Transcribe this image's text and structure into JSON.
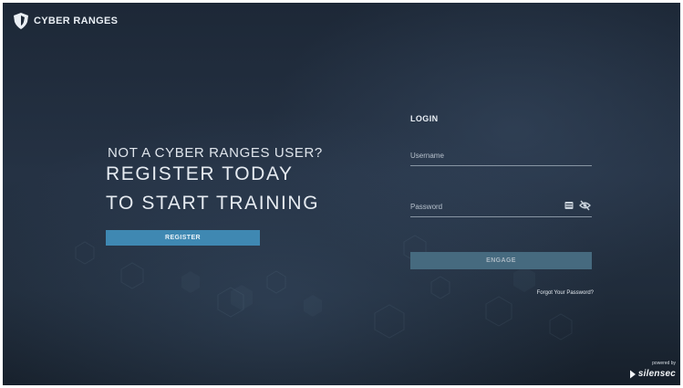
{
  "brand": {
    "logo_icon": "cyber-ranges-shield-icon",
    "name": "CYBER RANGES"
  },
  "promo": {
    "line1": "NOT A CYBER RANGES USER?",
    "line2": "REGISTER TODAY",
    "line3": "TO START TRAINING",
    "register_label": "REGISTER"
  },
  "login": {
    "title": "LOGIN",
    "username": {
      "placeholder": "Username",
      "value": ""
    },
    "password": {
      "placeholder": "Password",
      "value": "",
      "icons": [
        "password-card-icon",
        "eye-slash-icon"
      ]
    },
    "engage_label": "ENGAGE",
    "forgot_label": "Forgot Your Password?"
  },
  "footer": {
    "powered_by": "powered by",
    "company": "silensec",
    "company_icon": "silensec-play-icon"
  },
  "colors": {
    "background": "#212d3c",
    "register_button": "#3f88b2",
    "engage_button": "#466a7f",
    "text": "#e6ebf1"
  }
}
